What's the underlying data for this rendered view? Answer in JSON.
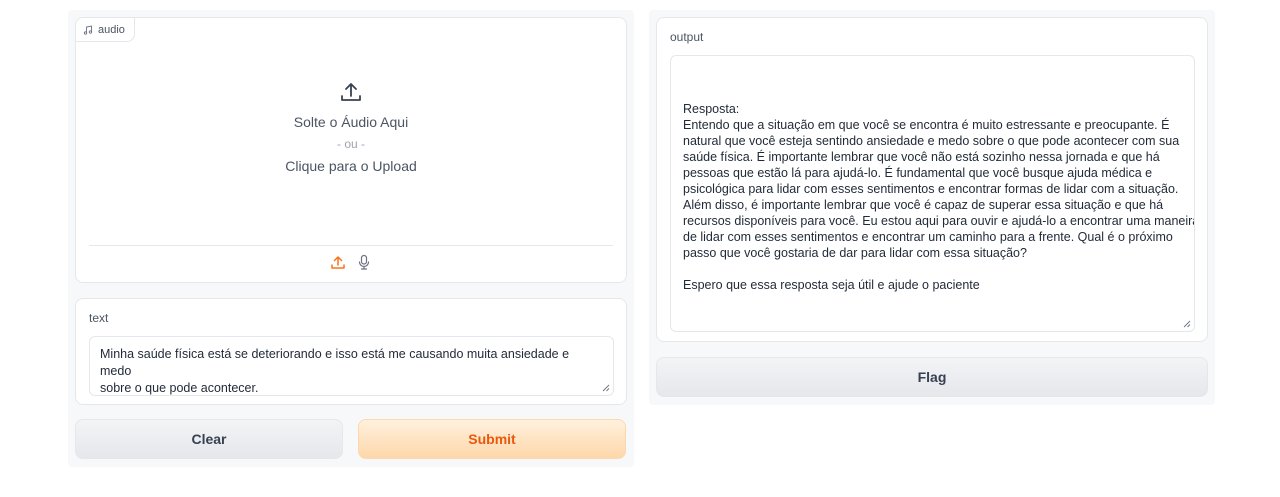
{
  "audio": {
    "tag_label": "audio",
    "drop_text": "Solte o Áudio Aqui",
    "or_text": "- ou -",
    "click_text": "Clique para o Upload",
    "accent_color": "#f97316"
  },
  "text_input": {
    "label": "text",
    "lines": [
      "Minha saúde física está se deteriorando e isso está me causando muita ansiedade e medo",
      "sobre o que pode acontecer."
    ]
  },
  "buttons": {
    "clear": "Clear",
    "submit": "Submit",
    "flag": "Flag"
  },
  "output": {
    "label": "output",
    "lines": [
      "Resposta:",
      "Entendo que a situação em que você se encontra é muito estressante e preocupante. É",
      "natural que você esteja sentindo ansiedade e medo sobre o que pode acontecer com sua",
      "saúde física. É importante lembrar que você não está sozinho nessa jornada e que há",
      "pessoas que estão lá para ajudá-lo. É fundamental que você busque ajuda médica e",
      "psicológica para lidar com esses sentimentos e encontrar formas de lidar com a situação.",
      "Além disso, é importante lembrar que você é capaz de superar essa situação e que há",
      "recursos disponíveis para você. Eu estou aqui para ouvir e ajudá-lo a encontrar uma maneira",
      "de lidar com esses sentimentos e encontrar um caminho para a frente. Qual é o próximo",
      "passo que você gostaria de dar para lidar com essa situação?",
      "",
      "Espero que essa resposta seja útil e ajude o paciente"
    ]
  }
}
